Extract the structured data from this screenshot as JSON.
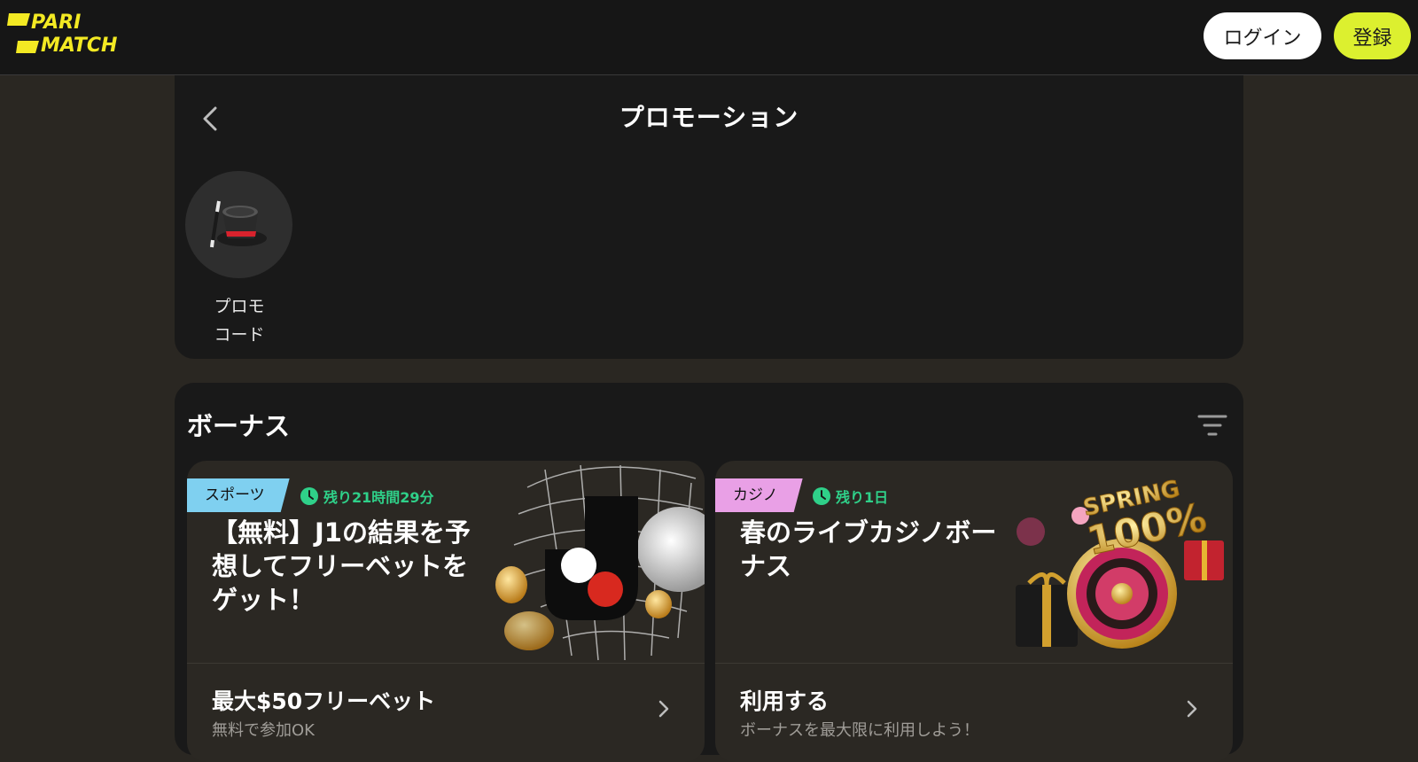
{
  "header": {
    "logo_lines": [
      "PARI",
      "MATCH"
    ],
    "login_label": "ログイン",
    "register_label": "登録"
  },
  "promotions": {
    "title": "プロモーション",
    "tiles": [
      {
        "label": "プロモ\nコード",
        "icon": "magic-hat-icon"
      }
    ]
  },
  "bonuses": {
    "title": "ボーナス",
    "cards": [
      {
        "tag": "スポーツ",
        "timer": "残り21時間29分",
        "title_lines": [
          "【無料】J1の結果を予",
          "想してフリーベットを",
          "ゲット！"
        ],
        "cta_main": "最大$50フリーベット",
        "cta_sub": "無料で参加OK",
        "art": "j1-soccer-net-illustration"
      },
      {
        "tag": "カジノ",
        "timer": "残り1日",
        "title_lines": [
          "春のライブカジノボー",
          "ナス"
        ],
        "cta_main": "利用する",
        "cta_sub": "ボーナスを最大限に利用しよう！",
        "art": "spring-100-roulette-illustration",
        "art_text": [
          "SPRING",
          "100%"
        ]
      }
    ]
  },
  "colors": {
    "brand_yellow": "#dcf02f",
    "header_bg": "#161616",
    "page_bg": "#2a2722",
    "panel_bg": "#191919",
    "card_bg": "#2b2823",
    "timer_green": "#2fd089",
    "sports_tag": "#7fd0f0",
    "casino_tag": "#e9a0e6"
  }
}
